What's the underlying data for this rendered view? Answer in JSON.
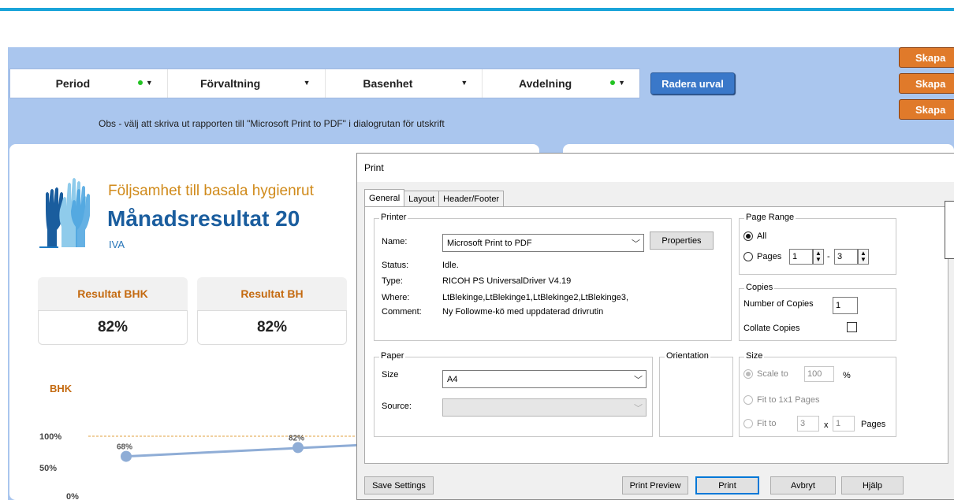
{
  "filters": [
    {
      "label": "Period",
      "active": true
    },
    {
      "label": "Förvaltning",
      "active": false
    },
    {
      "label": "Basenhet",
      "active": false
    },
    {
      "label": "Avdelning",
      "active": true
    }
  ],
  "radera_label": "Radera urval",
  "skapa_buttons": [
    "Skapa",
    "Skapa",
    "Skapa"
  ],
  "obs_text": "Obs - välj att skriva ut rapporten till \"Microsoft Print to PDF\" i dialogrutan för utskrift",
  "report": {
    "title1": "Följsamhet till basala hygienrut",
    "title2": "Månadsresultat 20",
    "unit": "IVA"
  },
  "kpis": [
    {
      "label": "Resultat BHK",
      "value": "82%"
    },
    {
      "label": "Resultat BH",
      "value": "82%"
    }
  ],
  "chart_data": {
    "type": "line",
    "title": "BHK",
    "y_ticks": [
      "100%",
      "50%",
      "0%"
    ],
    "ylim": [
      0,
      100
    ],
    "reference_line": 100,
    "points": [
      {
        "label": "68%",
        "value": 68
      },
      {
        "label": "82%",
        "value": 82
      }
    ]
  },
  "dialog": {
    "title": "Print",
    "tabs": [
      "General",
      "Layout",
      "Header/Footer"
    ],
    "printer": {
      "group": "Printer",
      "name_label": "Name:",
      "name_value": "Microsoft Print to PDF",
      "properties": "Properties",
      "status_label": "Status:",
      "status_value": "Idle.",
      "type_label": "Type:",
      "type_value": "RICOH PS UniversalDriver V4.19",
      "where_label": "Where:",
      "where_value": "LtBlekinge,LtBlekinge1,LtBlekinge2,LtBlekinge3,",
      "comment_label": "Comment:",
      "comment_value": "Ny Followme-kö med uppdaterad drivrutin"
    },
    "page_range": {
      "group": "Page Range",
      "all": "All",
      "pages": "Pages",
      "from": "1",
      "dash": "-",
      "to": "3"
    },
    "copies": {
      "group": "Copies",
      "number_label": "Number of Copies",
      "number_value": "1",
      "collate_label": "Collate Copies"
    },
    "paper": {
      "group": "Paper",
      "size_label": "Size",
      "size_value": "A4",
      "source_label": "Source:"
    },
    "orientation": {
      "group": "Orientation"
    },
    "size": {
      "group": "Size",
      "scale_label": "Scale to",
      "scale_value": "100",
      "percent": "%",
      "fit1_label": "Fit to 1x1 Pages",
      "fit_label": "Fit to",
      "fit_w": "3",
      "x": "x",
      "fit_h": "1",
      "pages_word": "Pages"
    },
    "buttons": {
      "save": "Save Settings",
      "preview": "Print Preview",
      "print": "Print",
      "cancel": "Avbryt",
      "help": "Hjälp"
    }
  }
}
